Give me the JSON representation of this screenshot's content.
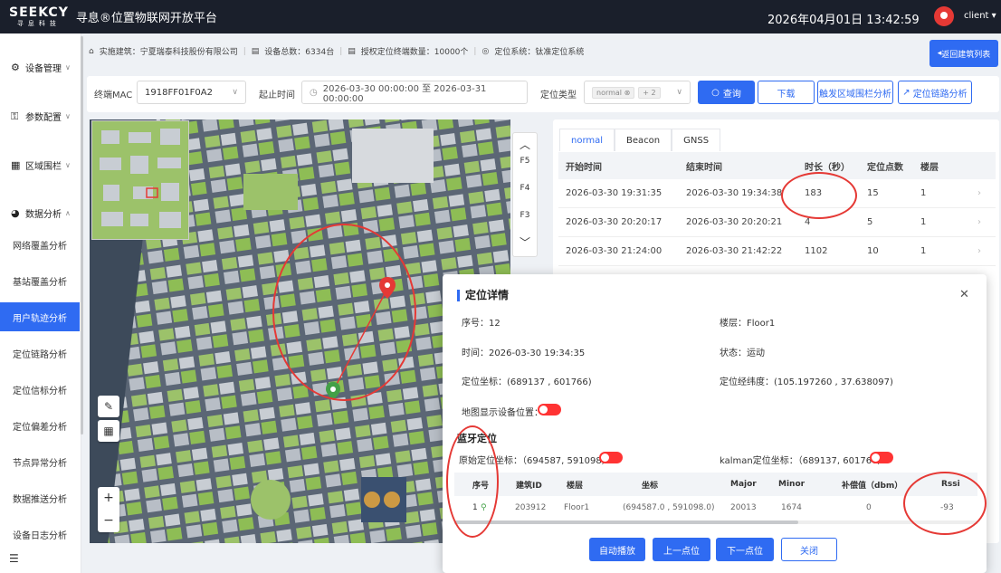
{
  "header": {
    "brand": "SEEKCY",
    "brand_sub": "寻息科技",
    "title": "寻息®位置物联网开放平台",
    "datetime": "2026年04月01日   13:42:59",
    "user": "client ▾"
  },
  "sidebar": {
    "groups": [
      {
        "label": "设备管理",
        "chev": "∨"
      },
      {
        "label": "参数配置",
        "chev": "∨"
      },
      {
        "label": "区域围栏",
        "chev": "∨"
      },
      {
        "label": "数据分析",
        "chev": "∧"
      }
    ],
    "items": [
      "网络覆盖分析",
      "基站覆盖分析",
      "用户轨迹分析",
      "定位链路分析",
      "定位信标分析",
      "定位偏差分析",
      "节点异常分析",
      "数据推送分析",
      "设备日志分析"
    ]
  },
  "info": {
    "building": "实施建筑：宁夏瑞泰科技股份有限公司",
    "devices": "设备总数：6334台",
    "licenses": "授权定位终端数量：10000个",
    "system": "定位系统：钛准定位系统",
    "back": "返回建筑列表"
  },
  "filter": {
    "mac_label": "终端MAC",
    "mac_value": "1918FF01F0A2",
    "time_label": "起止时间",
    "time_value": "2026-03-30 00:00:00 至 2026-03-31 00:00:00",
    "type_label": "定位类型",
    "type_tag1": "normal ⊗",
    "type_tag2": "+ 2",
    "query": "查询",
    "download": "下载",
    "fence": "触发区域围栏分析",
    "link": "定位链路分析"
  },
  "floors": {
    "labels": [
      "F5",
      "F4",
      "F3"
    ]
  },
  "map_tools": {
    "zoom_in": "+",
    "zoom_out": "−"
  },
  "table": {
    "tabs": [
      "normal",
      "Beacon",
      "GNSS"
    ],
    "headers": [
      "开始时间",
      "结束时间",
      "时长（秒）",
      "定位点数",
      "楼层"
    ],
    "rows": [
      [
        "2026-03-30 19:31:35",
        "2026-03-30 19:34:38",
        "183",
        "15",
        "1"
      ],
      [
        "2026-03-30 20:20:17",
        "2026-03-30 20:20:21",
        "4",
        "5",
        "1"
      ],
      [
        "2026-03-30 21:24:00",
        "2026-03-30 21:42:22",
        "1102",
        "10",
        "1"
      ]
    ]
  },
  "modal": {
    "title": "定位详情",
    "seq": "序号：12",
    "floor": "楼层：Floor1",
    "time": "时间：2026-03-30 19:34:35",
    "status": "状态：运动",
    "coord": "定位坐标：(689137 , 601766)",
    "latlng": "定位经纬度：(105.197260 , 37.638097)",
    "show_device": "地图显示设备位置：",
    "section": "蓝牙定位",
    "raw": "原始定位坐标：（694587, 591098）",
    "kalman": "kalman定位坐标：（689137, 601766）",
    "inner_headers": [
      "序号",
      "建筑ID",
      "楼层",
      "坐标",
      "Major",
      "Minor",
      "补偿值（dbm）",
      "Rssi"
    ],
    "inner_row": [
      "1",
      "203912",
      "Floor1",
      "(694587.0 , 591098.0)",
      "20013",
      "1674",
      "0",
      "-93"
    ],
    "buttons": [
      "自动播放",
      "上一点位",
      "下一点位",
      "关闭"
    ]
  }
}
